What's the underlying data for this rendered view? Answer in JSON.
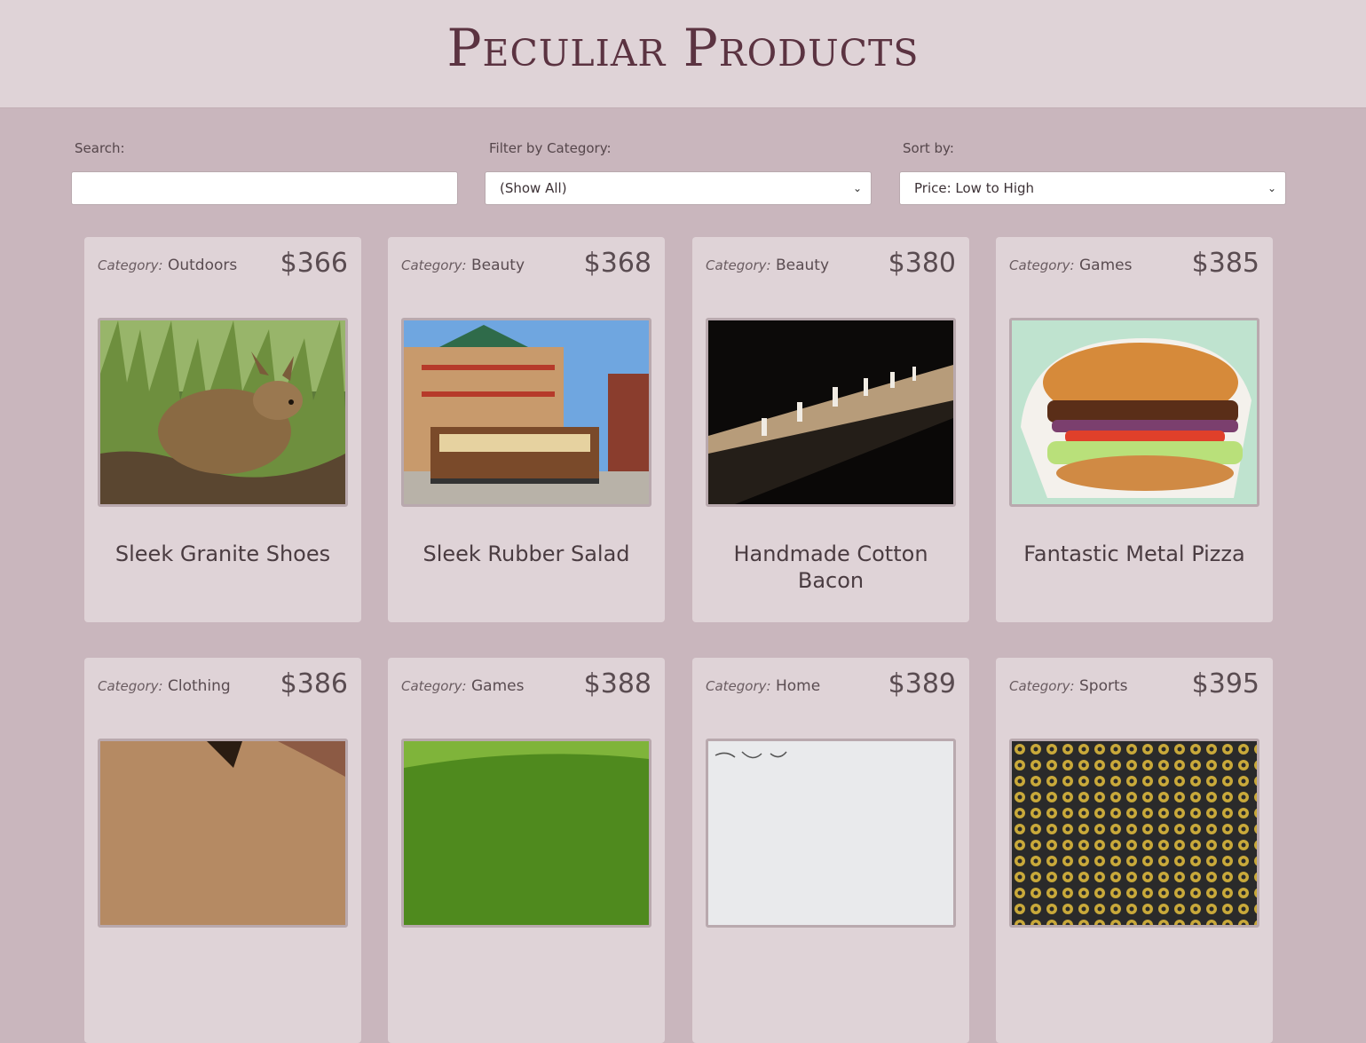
{
  "header": {
    "title": "Peculiar Products"
  },
  "controls": {
    "search_label": "Search:",
    "search_value": "",
    "filter_label": "Filter by Category:",
    "filter_value": "(Show All)",
    "sort_label": "Sort by:",
    "sort_value": "Price: Low to High"
  },
  "category_prefix": "Category:",
  "products": [
    {
      "category": "Outdoors",
      "price": "$366",
      "name": "Sleek Granite Shoes",
      "image": "deer-photo"
    },
    {
      "category": "Beauty",
      "price": "$368",
      "name": "Sleek Rubber Salad",
      "image": "cable-car-photo"
    },
    {
      "category": "Beauty",
      "price": "$380",
      "name": "Handmade Cotton Bacon",
      "image": "runway-photo"
    },
    {
      "category": "Games",
      "price": "$385",
      "name": "Fantastic Metal Pizza",
      "image": "burger-photo"
    },
    {
      "category": "Clothing",
      "price": "$386",
      "name": "",
      "image": "partial-photo"
    },
    {
      "category": "Games",
      "price": "$388",
      "name": "",
      "image": "grass-photo"
    },
    {
      "category": "Home",
      "price": "$389",
      "name": "",
      "image": "whiteboard-photo"
    },
    {
      "category": "Sports",
      "price": "$395",
      "name": "",
      "image": "pattern-photo"
    }
  ]
}
